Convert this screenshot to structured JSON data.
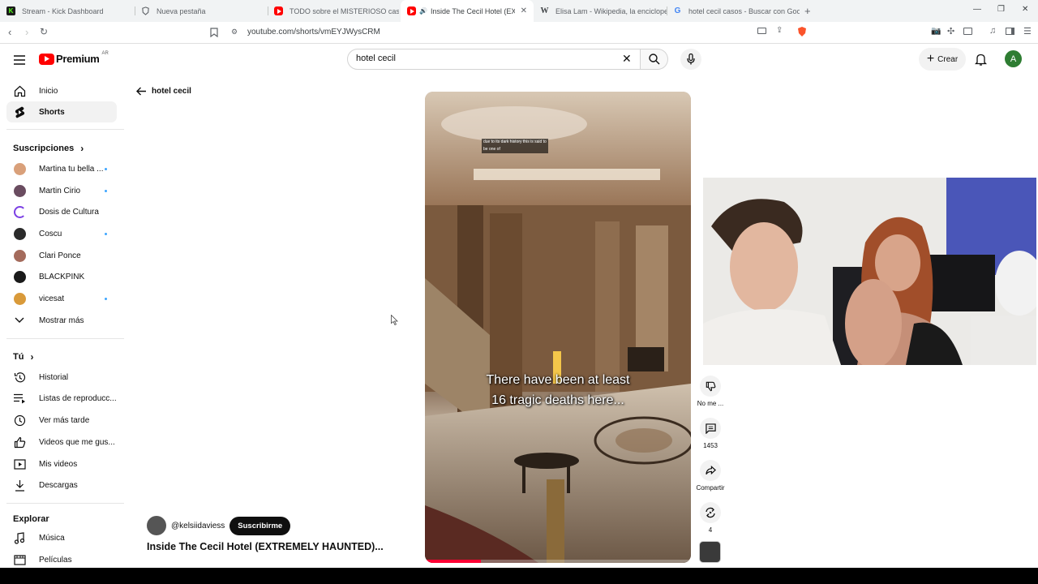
{
  "browser": {
    "tabs": [
      {
        "title": "Stream - Kick Dashboard",
        "color": "#53fc18",
        "glyph": "K"
      },
      {
        "title": "Nueva pestaña",
        "color": "#5f6368",
        "glyph": ""
      },
      {
        "title": "TODO sobre el MISTERIOSO caso de",
        "color": "#ff0000",
        "glyph": ""
      },
      {
        "title": "Inside The Cecil Hotel (EXTRE",
        "color": "#ff0000",
        "glyph": ""
      },
      {
        "title": "Elisa Lam - Wikipedia, la enciclopedi",
        "color": "#5f6368",
        "glyph": "W"
      },
      {
        "title": "hotel cecil casos - Buscar con Google",
        "color": "#4285f4",
        "glyph": "G"
      }
    ],
    "url": "youtube.com/shorts/vmEYJWysCRM"
  },
  "header": {
    "logo_text": "Premium",
    "region": "AR",
    "search_value": "hotel cecil",
    "create_label": "Crear",
    "avatar_letter": "A"
  },
  "sidebar": {
    "main": [
      {
        "label": "Inicio",
        "icon": "home-icon"
      },
      {
        "label": "Shorts",
        "icon": "shorts-icon"
      }
    ],
    "subs_title": "Suscripciones",
    "subscriptions": [
      {
        "label": "Martina tu bella ...",
        "color": "#d9a07a",
        "dot": true
      },
      {
        "label": "Martin Cirio",
        "color": "#6a4c60",
        "dot": true
      },
      {
        "label": "Dosis de Cultura",
        "color": "#ffffff",
        "dot": false
      },
      {
        "label": "Coscu",
        "color": "#2b2b2b",
        "dot": true
      },
      {
        "label": "Clari Ponce",
        "color": "#a46b5c",
        "dot": false
      },
      {
        "label": "BLACKPINK",
        "color": "#1a1a1a",
        "dot": false
      },
      {
        "label": "vicesat",
        "color": "#d99a3a",
        "dot": true
      }
    ],
    "show_more": "Mostrar más",
    "you_title": "Tú",
    "you_items": [
      {
        "label": "Historial",
        "icon": "history-icon"
      },
      {
        "label": "Listas de reproducc...",
        "icon": "playlists-icon"
      },
      {
        "label": "Ver más tarde",
        "icon": "watch-later-icon"
      },
      {
        "label": "Videos que me gus...",
        "icon": "like-icon"
      },
      {
        "label": "Mis videos",
        "icon": "my-videos-icon"
      },
      {
        "label": "Descargas",
        "icon": "download-icon"
      }
    ],
    "explore_title": "Explorar",
    "explore_items": [
      {
        "label": "Música",
        "icon": "music-icon"
      },
      {
        "label": "Películas",
        "icon": "movies-icon"
      }
    ]
  },
  "back": {
    "label": "hotel cecil"
  },
  "short": {
    "channel": "@kelsiidaviess",
    "subscribe_label": "Suscribirme",
    "title": "Inside The Cecil Hotel (EXTREMELY HAUNTED)...",
    "caption_main_line1": "There have been at least",
    "caption_main_line2": "16 tragic deaths here...",
    "caption_small_line1": "due to its dark history this is said to",
    "caption_small_line2": "be one of"
  },
  "actions": {
    "dislike_label": "No me ...",
    "comments_count": "1453",
    "share_label": "Compartir",
    "remix_count": "4"
  }
}
